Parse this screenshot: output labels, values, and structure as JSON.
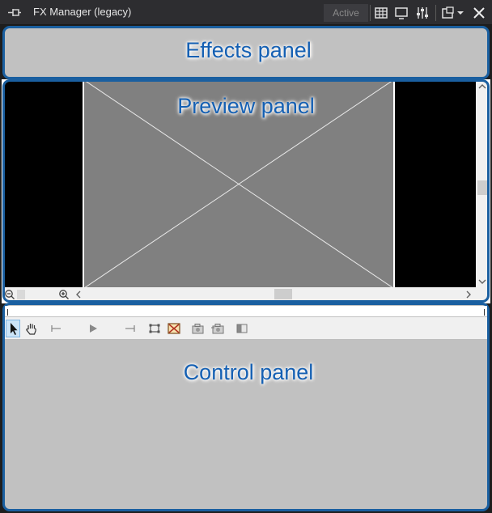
{
  "window": {
    "title": "FX Manager (legacy)",
    "status_button": "Active"
  },
  "toolbar_icons": [
    "pin-icon",
    "grid-icon",
    "monitor-icon",
    "sliders-icon",
    "settings-dropdown-icon",
    "close-icon"
  ],
  "panels": {
    "effects": {
      "label": "Effects panel"
    },
    "preview": {
      "label": "Preview panel"
    },
    "control": {
      "label": "Control panel"
    }
  },
  "preview_scroll": {
    "vertical_position": 0.53,
    "horizontal_position": 0.6
  },
  "control_toolbar_icons": [
    "select-arrow-icon",
    "hand-icon",
    "go-to-start-icon",
    "play-icon",
    "go-to-end-icon",
    "crop-icon",
    "image-icon",
    "camera-icon",
    "camera-add-icon",
    "split-view-icon"
  ],
  "colors": {
    "accent": "#1a5fa0",
    "label": "#1560b3",
    "panel_bg": "#c1c1c1",
    "titlebar": "#2d2d30",
    "preview_canvas": "#808080"
  }
}
